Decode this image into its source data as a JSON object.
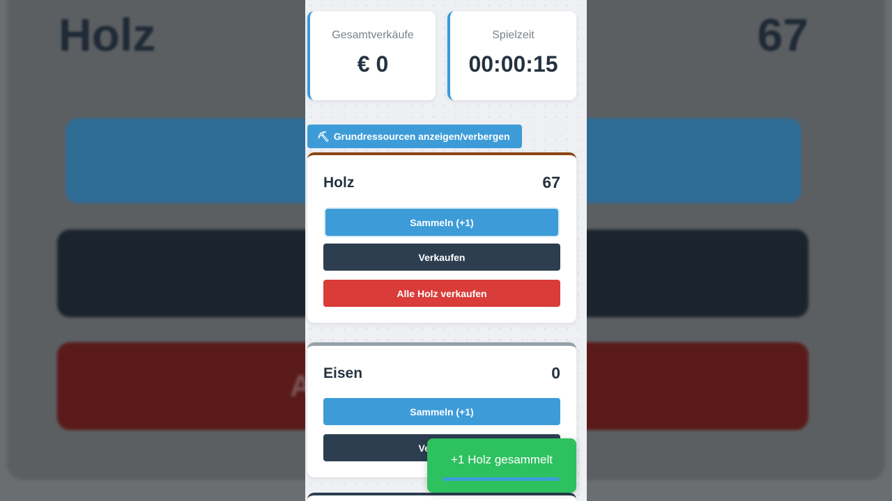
{
  "backdrop": {
    "title": "Holz",
    "count": "67",
    "button_fragment": "A"
  },
  "stats": {
    "total_sales_label": "Gesamtverkäufe",
    "total_sales_value": "€ 0",
    "playtime_label": "Spielzeit",
    "playtime_value": "00:00:15"
  },
  "toggle": {
    "icon": "pickaxe-icon",
    "label": "Grundressourcen anzeigen/verbergen"
  },
  "resources": [
    {
      "name": "Holz",
      "count": "67",
      "collect_label": "Sammeln (+1)",
      "sell_label": "Verkaufen",
      "sell_all_label": "Alle Holz verkaufen",
      "accent": "#8b4513"
    },
    {
      "name": "Eisen",
      "count": "0",
      "collect_label": "Sammeln (+1)",
      "sell_label": "Verkaufen",
      "accent": "#95a0a8"
    }
  ],
  "toast": {
    "message": "+1 Holz gesammelt",
    "color": "#2ec15f"
  },
  "colors": {
    "primary": "#3d9cd8",
    "dark": "#2c3e50",
    "danger": "#d93c39"
  }
}
